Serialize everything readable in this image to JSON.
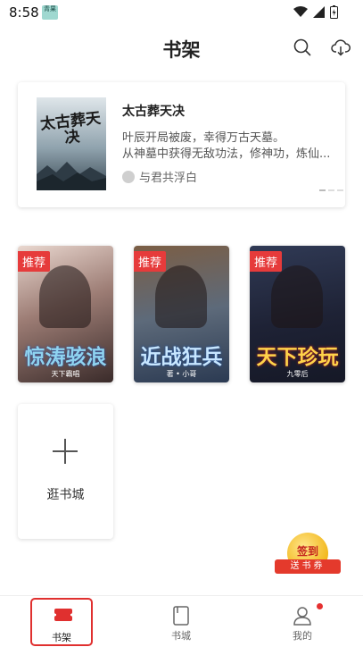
{
  "status_bar": {
    "time": "8:58",
    "app_icon_text": "青果"
  },
  "header": {
    "title": "书架",
    "search_icon": "search-icon",
    "download_icon": "cloud-download-icon"
  },
  "banner": {
    "cover_title": "太古葬天决",
    "title": "太古葬天决",
    "description_lines": [
      "叶辰开局被废，幸得万古天墓。",
      "从神墓中获得无敌功法，修神功，炼仙..."
    ],
    "author": "与君共浮白"
  },
  "books": [
    {
      "badge": "推荐",
      "cover_title": "惊涛骇浪",
      "cover_sub": "天下霸唱"
    },
    {
      "badge": "推荐",
      "cover_title": "近战狂兵",
      "cover_sub": "著 • 小哥"
    },
    {
      "badge": "推荐",
      "cover_title": "天下珍玩",
      "cover_sub": "九零后"
    }
  ],
  "add_card": {
    "label": "逛书城"
  },
  "signin": {
    "title": "签到",
    "ribbon": "送书券"
  },
  "tabbar": {
    "items": [
      {
        "label": "书架",
        "icon": "bookshelf-icon",
        "active": true
      },
      {
        "label": "书城",
        "icon": "book-icon",
        "active": false
      },
      {
        "label": "我的",
        "icon": "user-icon",
        "active": false,
        "has_dot": true
      }
    ]
  },
  "colors": {
    "accent": "#e0302f",
    "badge": "#e63b3b"
  }
}
